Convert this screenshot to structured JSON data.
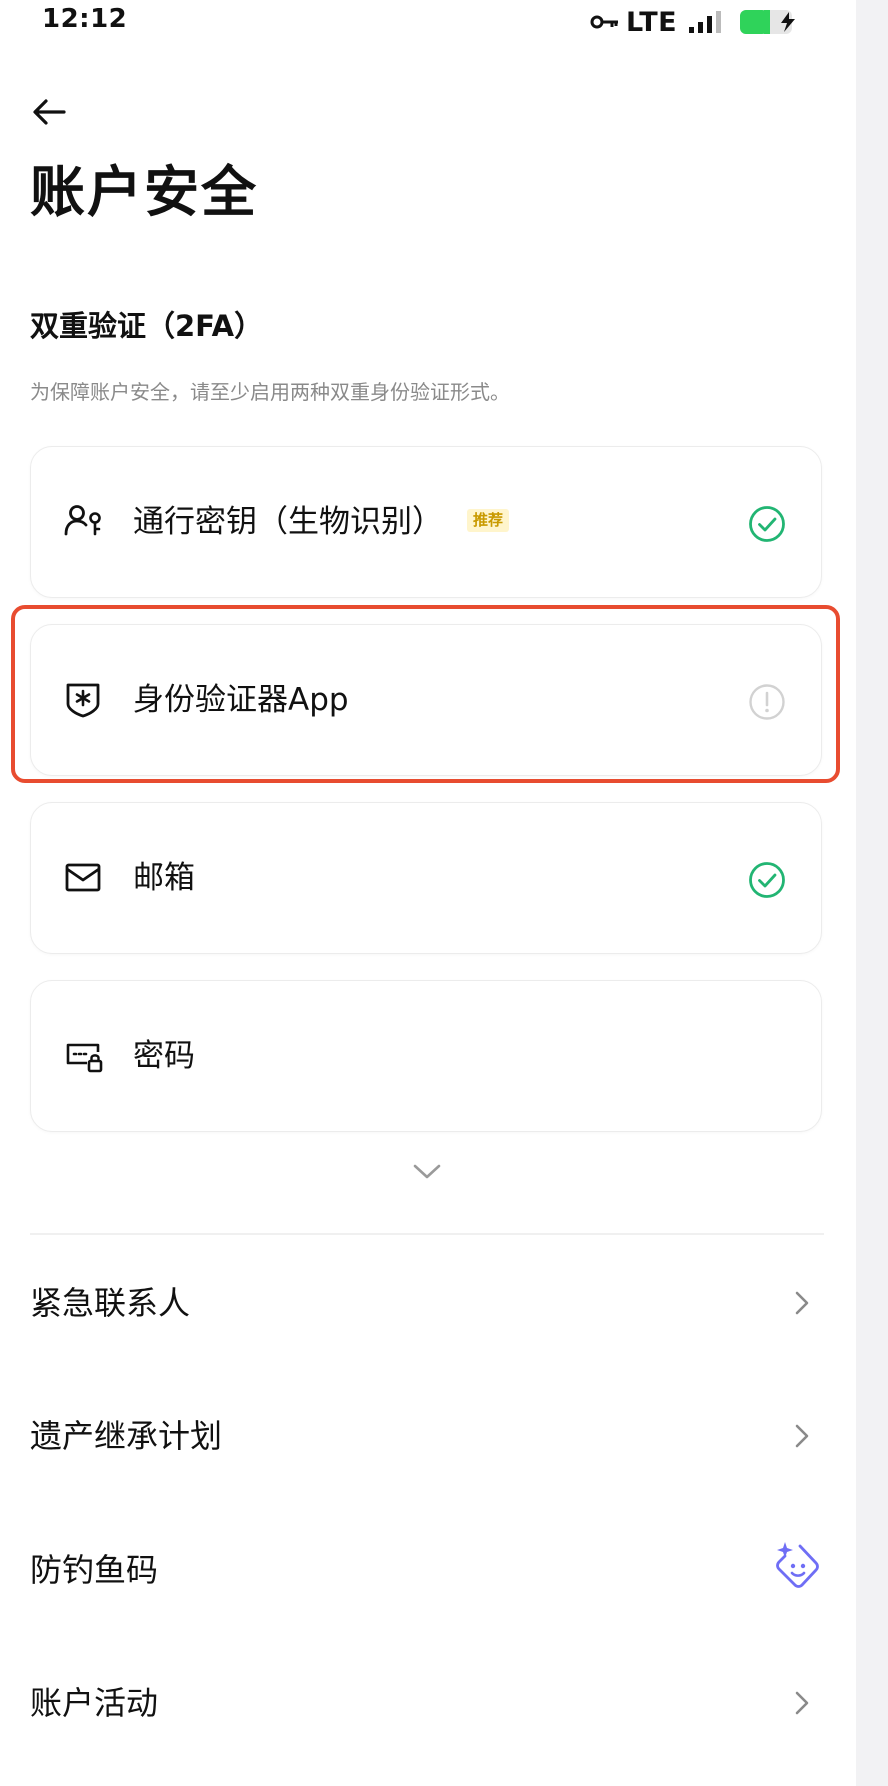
{
  "status_bar": {
    "time": "12:12",
    "network": "LTE",
    "battery_color": "#2fd35a"
  },
  "header": {
    "title": "账户安全"
  },
  "two_factor": {
    "title": "双重验证（2FA）",
    "description": "为保障账户安全，请至少启用两种双重身份验证形式。",
    "items": [
      {
        "label": "通行密钥（生物识别）",
        "badge": "推荐",
        "icon": "passkey-user-icon",
        "status": "enabled"
      },
      {
        "label": "身份验证器App",
        "icon": "authenticator-shield-icon",
        "status": "warning"
      },
      {
        "label": "邮箱",
        "icon": "mail-icon",
        "status": "enabled"
      },
      {
        "label": "密码",
        "icon": "password-lock-icon",
        "status": "none"
      }
    ]
  },
  "more_items": [
    {
      "label": "紧急联系人",
      "icon": "chevron-right-icon"
    },
    {
      "label": "遗产继承计划",
      "icon": "chevron-right-icon"
    },
    {
      "label": "防钓鱼码",
      "icon": "anti-phishing-sparkle-icon"
    },
    {
      "label": "账户活动",
      "icon": "chevron-right-icon"
    }
  ],
  "colors": {
    "accent_green": "#22b573",
    "highlight_red": "#e84c30",
    "badge_text": "#c99a00",
    "badge_bg": "#fff5cc",
    "anti_phish": "#6f6ef5"
  }
}
